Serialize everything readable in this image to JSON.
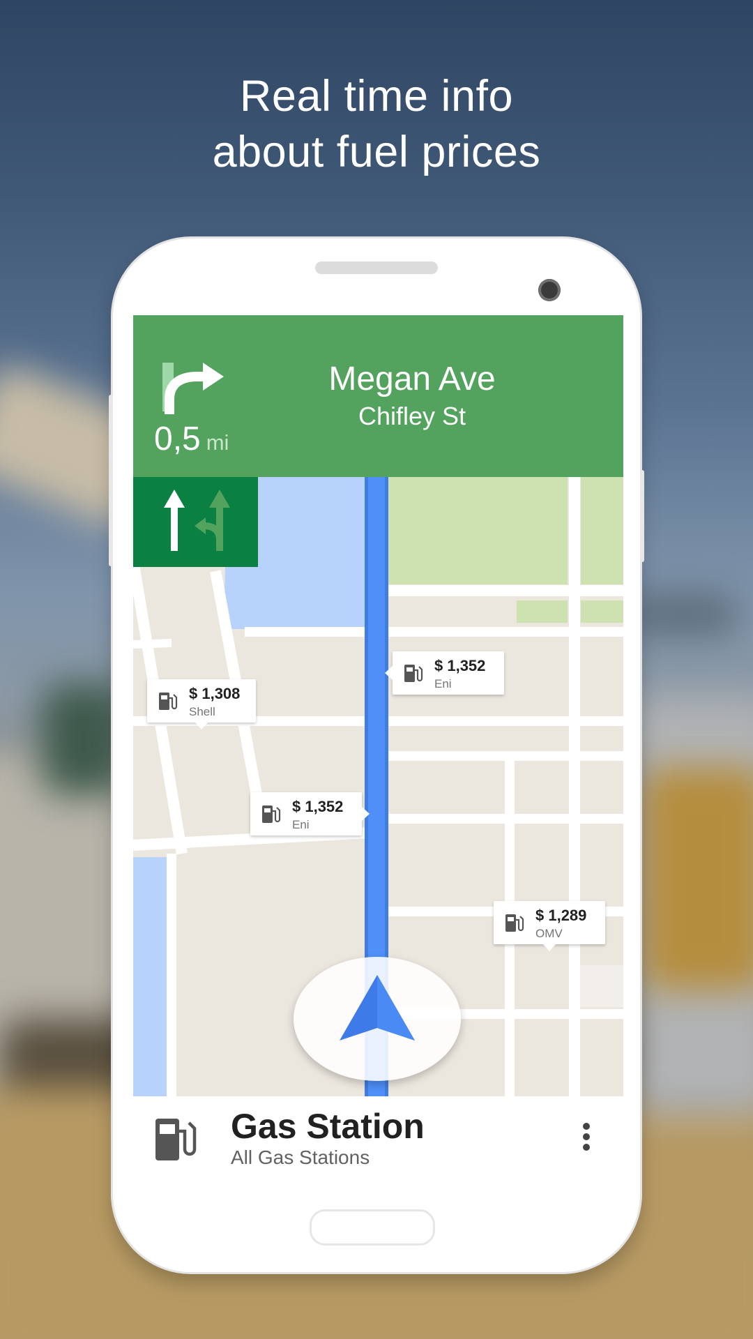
{
  "headline": {
    "line1": "Real time info",
    "line2": "about fuel prices"
  },
  "navigation": {
    "maneuver_icon": "turn-right-icon",
    "distance_value": "0,5",
    "distance_unit": "mi",
    "street_main": "Megan Ave",
    "street_sub": "Chifley St",
    "lane_icons": [
      "straight-arrow-icon",
      "straight-or-left-arrow-icon"
    ]
  },
  "map": {
    "route_color": "#4285f4",
    "header_color": "#53a35e",
    "lane_box_color": "#0b8043",
    "stations": [
      {
        "price": "$ 1,308",
        "brand": "Shell"
      },
      {
        "price": "$ 1,352",
        "brand": "Eni"
      },
      {
        "price": "$ 1,352",
        "brand": "Eni"
      },
      {
        "price": "$ 1,289",
        "brand": "OMV"
      }
    ]
  },
  "bottom_panel": {
    "icon": "gas-pump-icon",
    "title": "Gas Station",
    "subtitle": "All Gas Stations",
    "menu_icon": "more-vert-icon"
  }
}
